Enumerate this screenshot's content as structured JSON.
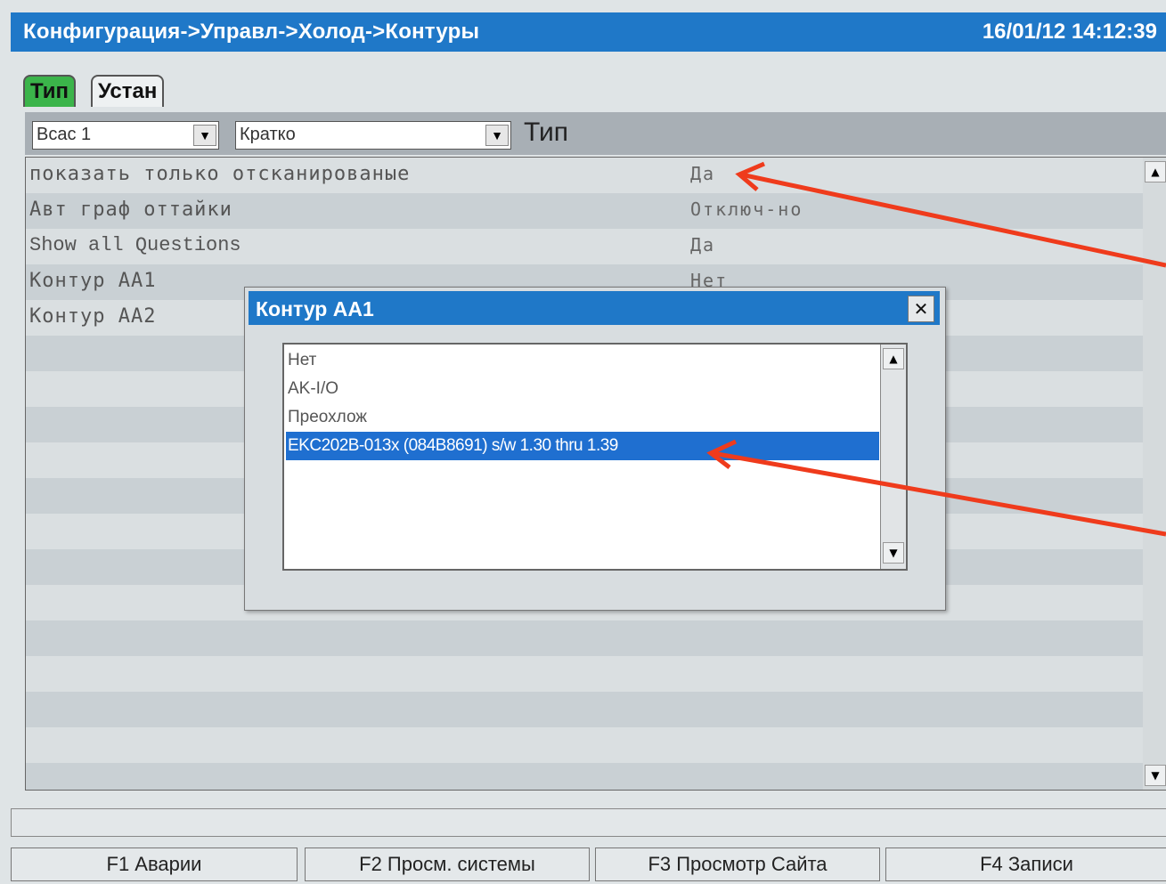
{
  "window": {
    "title": "Конфигурация->Управл->Холод->Контуры",
    "datetime": "16/01/12 14:12:39"
  },
  "tabs": [
    {
      "label": "Тип"
    },
    {
      "label": "Устан"
    }
  ],
  "toolbar": {
    "bus_select": "Bcac 1",
    "view_select": "Кратко",
    "label": "Тип"
  },
  "rows": [
    {
      "label": "показать только отсканированые",
      "value": "Да"
    },
    {
      "label": "Авт граф оттайки",
      "value": "Отключ-но"
    },
    {
      "label": "Show all Questions",
      "value": "Да"
    },
    {
      "label": "Контур AA1",
      "value": "Нет"
    },
    {
      "label": "Контур AA2",
      "value": ""
    }
  ],
  "dialog": {
    "title": "Контур AA1",
    "options": [
      {
        "label": "Нет"
      },
      {
        "label": "AK-I/O"
      },
      {
        "label": "Преохлож"
      },
      {
        "label": "EKC202B-013x (084B8691) s/w 1.30 thru 1.39"
      }
    ],
    "selected_index": 3
  },
  "fkeys": [
    "F1 Аварии",
    "F2 Просм. системы",
    "F3 Просмотр Сайта",
    "F4 Записи"
  ],
  "colors": {
    "title_bar": "#1f78c8",
    "active_tab": "#3bb44a",
    "selection": "#1f6fd0",
    "annotation_arrow": "#ef3b1c"
  }
}
